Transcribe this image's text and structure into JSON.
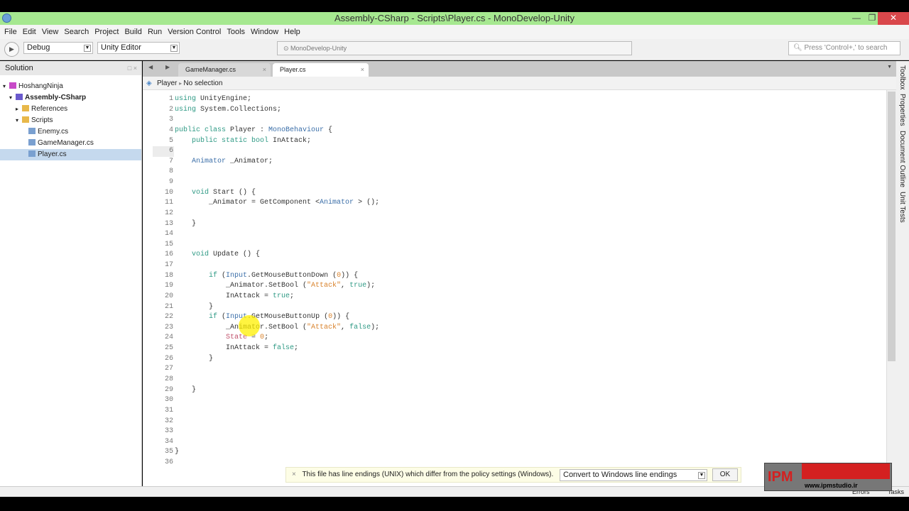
{
  "window": {
    "title": "Assembly-CSharp - Scripts\\Player.cs - MonoDevelop-Unity",
    "minimize": "—",
    "maximize": "❐",
    "close": "✕"
  },
  "menu": [
    "File",
    "Edit",
    "View",
    "Search",
    "Project",
    "Build",
    "Run",
    "Version Control",
    "Tools",
    "Window",
    "Help"
  ],
  "toolbar": {
    "config": "Debug",
    "target": "Unity Editor",
    "status": "MonoDevelop-Unity",
    "search_placeholder": "Press 'Control+,' to search"
  },
  "solution": {
    "title": "Solution",
    "items": [
      {
        "label": "HoshangNinja",
        "depth": 0,
        "arrow": "▾",
        "icon": "solution"
      },
      {
        "label": "Assembly-CSharp",
        "depth": 1,
        "arrow": "▾",
        "icon": "project",
        "bold": true
      },
      {
        "label": "References",
        "depth": 2,
        "arrow": "▸",
        "icon": "folder"
      },
      {
        "label": "Scripts",
        "depth": 2,
        "arrow": "▾",
        "icon": "folder"
      },
      {
        "label": "Enemy.cs",
        "depth": 3,
        "arrow": "",
        "icon": "file"
      },
      {
        "label": "GameManager.cs",
        "depth": 3,
        "arrow": "",
        "icon": "file"
      },
      {
        "label": "Player.cs",
        "depth": 3,
        "arrow": "",
        "icon": "file",
        "selected": true
      }
    ]
  },
  "tabs": [
    {
      "label": "GameManager.cs",
      "active": false
    },
    {
      "label": "Player.cs",
      "active": true
    }
  ],
  "breadcrumb": {
    "class": "Player",
    "member": "No selection"
  },
  "code": [
    [
      [
        "using",
        "kw"
      ],
      [
        " UnityEngine;",
        ""
      ]
    ],
    [
      [
        "using",
        "kw"
      ],
      [
        " System.Collections;",
        ""
      ]
    ],
    [],
    [
      [
        "public class",
        "kw"
      ],
      [
        " Player : ",
        ""
      ],
      [
        "MonoBehaviour",
        "ty"
      ],
      [
        " {",
        ""
      ]
    ],
    [
      [
        "    public static bool",
        "kw"
      ],
      [
        " InAttack;",
        ""
      ]
    ],
    [],
    [
      [
        "    Animator",
        "ty"
      ],
      [
        " _Animator;",
        ""
      ]
    ],
    [],
    [],
    [
      [
        "    void",
        "kw"
      ],
      [
        " Start () {",
        ""
      ]
    ],
    [
      [
        "        _Animator = GetComponent <",
        ""
      ],
      [
        "Animator",
        "ty"
      ],
      [
        " > ();",
        ""
      ]
    ],
    [],
    [
      [
        "    }",
        ""
      ]
    ],
    [],
    [],
    [
      [
        "    void",
        "kw"
      ],
      [
        " Update () {",
        ""
      ]
    ],
    [],
    [
      [
        "        if",
        "kw"
      ],
      [
        " (",
        ""
      ],
      [
        "Input",
        "ty"
      ],
      [
        ".GetMouseButtonDown (",
        ""
      ],
      [
        "0",
        "nu"
      ],
      [
        ")) {",
        ""
      ]
    ],
    [
      [
        "            _Animator.SetBool (",
        ""
      ],
      [
        "\"Attack\"",
        "st"
      ],
      [
        ", ",
        ""
      ],
      [
        "true",
        "kw"
      ],
      [
        ");",
        ""
      ]
    ],
    [
      [
        "            InAttack = ",
        ""
      ],
      [
        "true",
        "kw"
      ],
      [
        ";",
        ""
      ]
    ],
    [
      [
        "        }",
        ""
      ]
    ],
    [
      [
        "        if",
        "kw"
      ],
      [
        " (",
        ""
      ],
      [
        "Input",
        "ty"
      ],
      [
        ".GetMouseButtonUp (",
        ""
      ],
      [
        "0",
        "nu"
      ],
      [
        ")) {",
        ""
      ]
    ],
    [
      [
        "            _Animator.SetBool (",
        ""
      ],
      [
        "\"Attack\"",
        "st"
      ],
      [
        ", ",
        ""
      ],
      [
        "false",
        "kw"
      ],
      [
        ");",
        ""
      ]
    ],
    [
      [
        "            State",
        "va"
      ],
      [
        " = ",
        ""
      ],
      [
        "0",
        "nu"
      ],
      [
        ";",
        ""
      ]
    ],
    [
      [
        "            InAttack = ",
        ""
      ],
      [
        "false",
        "kw"
      ],
      [
        ";",
        ""
      ]
    ],
    [
      [
        "        }",
        ""
      ]
    ],
    [],
    [],
    [
      [
        "    }",
        ""
      ]
    ],
    [],
    [],
    [],
    [],
    [],
    [
      [
        "}",
        ""
      ]
    ],
    []
  ],
  "dock": [
    "Toolbox",
    "Properties",
    "Document Outline",
    "Unit Tests"
  ],
  "infobar": {
    "message": "This file has line endings (UNIX) which differ from the policy settings (Windows).",
    "option": "Convert to Windows line endings",
    "ok": "OK",
    "close": "×"
  },
  "statusbar": {
    "errors": "Errors",
    "tasks": "Tasks"
  },
  "watermark": "IPM www.ipmstudio.ir"
}
